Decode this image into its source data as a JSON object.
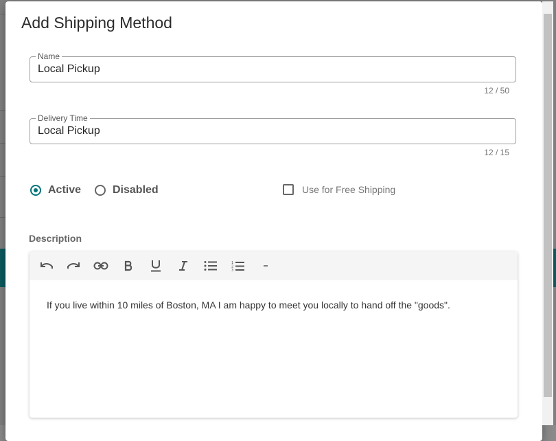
{
  "dialog": {
    "title": "Add Shipping Method"
  },
  "fields": {
    "name": {
      "label": "Name",
      "value": "Local Pickup",
      "counter": "12 / 50"
    },
    "delivery_time": {
      "label": "Delivery Time",
      "value": "Local Pickup",
      "counter": "12 / 15"
    }
  },
  "status": {
    "options": [
      {
        "label": "Active",
        "selected": true
      },
      {
        "label": "Disabled",
        "selected": false
      }
    ]
  },
  "free_shipping": {
    "label": "Use for Free Shipping",
    "checked": false
  },
  "description": {
    "label": "Description",
    "toolbar": [
      "undo-icon",
      "redo-icon",
      "link-icon",
      "bold-icon",
      "underline-icon",
      "italic-icon",
      "bullet-list-icon",
      "numbered-list-icon",
      "horizontal-rule-icon"
    ],
    "content": "If you live within 10 miles of Boston, MA I am happy to meet you locally to hand off the \"goods\"."
  },
  "colors": {
    "accent": "#00737a"
  }
}
